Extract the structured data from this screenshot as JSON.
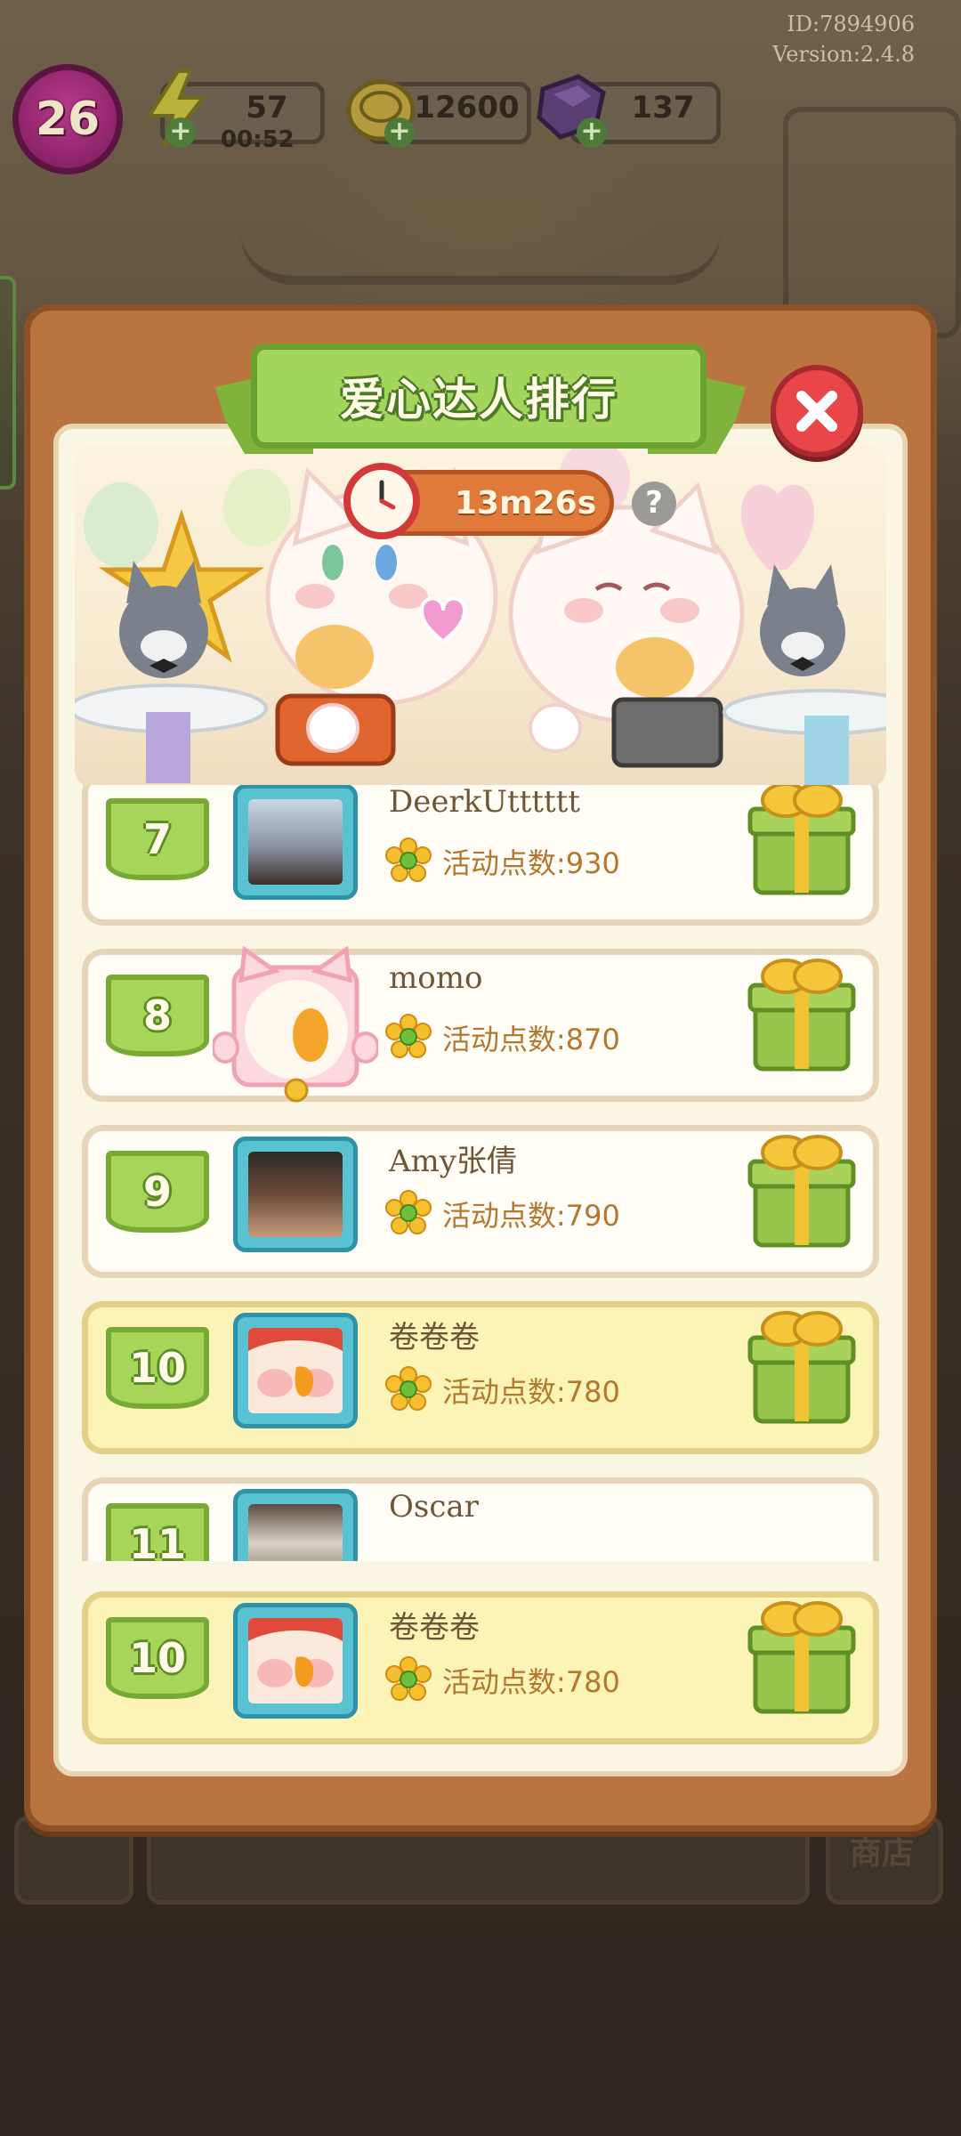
{
  "hud": {
    "user_id": "ID:7894906",
    "version": "Version:2.4.8",
    "level": "26",
    "energy": "57",
    "energy_timer": "00:52",
    "coins": "12600",
    "gems": "137"
  },
  "modal": {
    "title": "爱心达人排行",
    "countdown": "13m26s",
    "help_label": "?"
  },
  "colors": {
    "frame": "#b9743f",
    "title_green": "#a3d45b",
    "self_row": "#fbf4b6",
    "close_red": "#e9464a",
    "avatar_frame": "#58c2d3"
  },
  "ranking": [
    {
      "rank": "7",
      "name": "DeerkUtttttt",
      "points": "活动点数:930",
      "avatar": "photo-boy-icon"
    },
    {
      "rank": "8",
      "name": "momo",
      "points": "活动点数:870",
      "avatar": "pink-cat-frame-icon"
    },
    {
      "rank": "9",
      "name": "Amy张倩",
      "points": "活动点数:790",
      "avatar": "photo-girl-icon"
    },
    {
      "rank": "10",
      "name": "卷卷卷",
      "points": "活动点数:780",
      "avatar": "duck-avatar-icon",
      "self": true
    },
    {
      "rank": "11",
      "name": "Oscar",
      "points": "",
      "avatar": "photo-cat-icon"
    }
  ],
  "my_rank": {
    "rank": "10",
    "name": "卷卷卷",
    "points": "活动点数:780",
    "avatar": "duck-avatar-icon"
  },
  "bottom_bar": {
    "shop_label": "商店"
  }
}
